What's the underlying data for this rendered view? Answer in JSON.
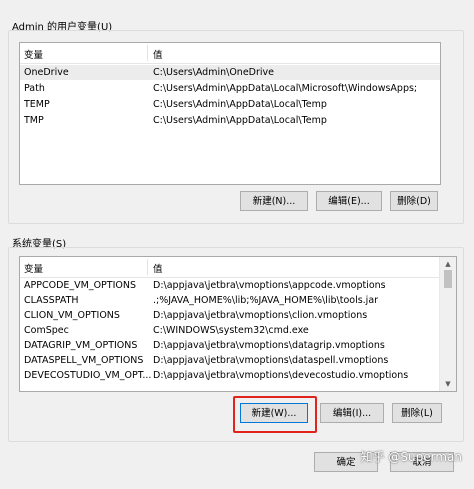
{
  "user_vars": {
    "group_label": "Admin 的用户变量(U)",
    "col_var": "变量",
    "col_val": "值",
    "rows": [
      {
        "name": "OneDrive",
        "value": "C:\\Users\\Admin\\OneDrive"
      },
      {
        "name": "Path",
        "value": "C:\\Users\\Admin\\AppData\\Local\\Microsoft\\WindowsApps;"
      },
      {
        "name": "TEMP",
        "value": "C:\\Users\\Admin\\AppData\\Local\\Temp"
      },
      {
        "name": "TMP",
        "value": "C:\\Users\\Admin\\AppData\\Local\\Temp"
      }
    ],
    "btn_new": "新建(N)...",
    "btn_edit": "编辑(E)...",
    "btn_delete": "删除(D)"
  },
  "system_vars": {
    "group_label": "系统变量(S)",
    "col_var": "变量",
    "col_val": "值",
    "rows": [
      {
        "name": "APPCODE_VM_OPTIONS",
        "value": "D:\\appjava\\jetbra\\vmoptions\\appcode.vmoptions"
      },
      {
        "name": "CLASSPATH",
        "value": ".;%JAVA_HOME%\\lib;%JAVA_HOME%\\lib\\tools.jar"
      },
      {
        "name": "CLION_VM_OPTIONS",
        "value": "D:\\appjava\\jetbra\\vmoptions\\clion.vmoptions"
      },
      {
        "name": "ComSpec",
        "value": "C:\\WINDOWS\\system32\\cmd.exe"
      },
      {
        "name": "DATAGRIP_VM_OPTIONS",
        "value": "D:\\appjava\\jetbra\\vmoptions\\datagrip.vmoptions"
      },
      {
        "name": "DATASPELL_VM_OPTIONS",
        "value": "D:\\appjava\\jetbra\\vmoptions\\dataspell.vmoptions"
      },
      {
        "name": "DEVECOSTUDIO_VM_OPT...",
        "value": "D:\\appjava\\jetbra\\vmoptions\\devecostudio.vmoptions"
      }
    ],
    "btn_new": "新建(W)...",
    "btn_edit": "编辑(I)...",
    "btn_delete": "删除(L)"
  },
  "footer": {
    "btn_ok": "确定",
    "btn_cancel": "取消"
  },
  "watermark": "知乎 @Superman"
}
